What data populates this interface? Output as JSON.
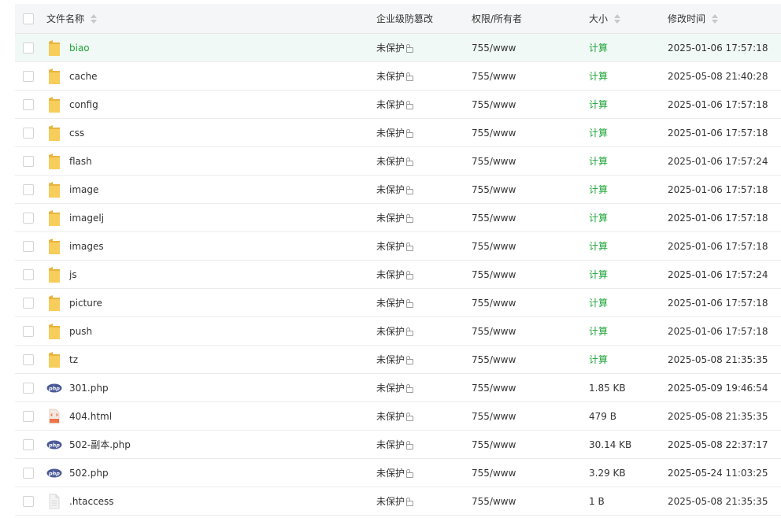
{
  "columns": {
    "name": "文件名称",
    "protect": "企业级防篡改",
    "perm": "权限/所有者",
    "size": "大小",
    "mtime": "修改时间"
  },
  "colors": {
    "accent_green": "#20a53a",
    "selected_row_bg": "#f1f9f6",
    "header_bg": "#f5f6f7",
    "folder": "#f4c752",
    "php_badge": "#4c5b97",
    "html_icon": "#ee7148"
  },
  "files": [
    {
      "name": "biao",
      "type": "folder",
      "icon": "folder-icon",
      "protect": "未保护",
      "perm": "755/www",
      "size": "计算",
      "mtime": "2025-01-06 17:57:18",
      "selected": true
    },
    {
      "name": "cache",
      "type": "folder",
      "icon": "folder-icon",
      "protect": "未保护",
      "perm": "755/www",
      "size": "计算",
      "mtime": "2025-05-08 21:40:28"
    },
    {
      "name": "config",
      "type": "folder",
      "icon": "folder-icon",
      "protect": "未保护",
      "perm": "755/www",
      "size": "计算",
      "mtime": "2025-01-06 17:57:18"
    },
    {
      "name": "css",
      "type": "folder",
      "icon": "folder-icon",
      "protect": "未保护",
      "perm": "755/www",
      "size": "计算",
      "mtime": "2025-01-06 17:57:18"
    },
    {
      "name": "flash",
      "type": "folder",
      "icon": "folder-icon",
      "protect": "未保护",
      "perm": "755/www",
      "size": "计算",
      "mtime": "2025-01-06 17:57:24"
    },
    {
      "name": "image",
      "type": "folder",
      "icon": "folder-icon",
      "protect": "未保护",
      "perm": "755/www",
      "size": "计算",
      "mtime": "2025-01-06 17:57:18"
    },
    {
      "name": "imagelj",
      "type": "folder",
      "icon": "folder-icon",
      "protect": "未保护",
      "perm": "755/www",
      "size": "计算",
      "mtime": "2025-01-06 17:57:18"
    },
    {
      "name": "images",
      "type": "folder",
      "icon": "folder-icon",
      "protect": "未保护",
      "perm": "755/www",
      "size": "计算",
      "mtime": "2025-01-06 17:57:18"
    },
    {
      "name": "js",
      "type": "folder",
      "icon": "folder-icon",
      "protect": "未保护",
      "perm": "755/www",
      "size": "计算",
      "mtime": "2025-01-06 17:57:24"
    },
    {
      "name": "picture",
      "type": "folder",
      "icon": "folder-icon",
      "protect": "未保护",
      "perm": "755/www",
      "size": "计算",
      "mtime": "2025-01-06 17:57:18"
    },
    {
      "name": "push",
      "type": "folder",
      "icon": "folder-icon",
      "protect": "未保护",
      "perm": "755/www",
      "size": "计算",
      "mtime": "2025-01-06 17:57:18"
    },
    {
      "name": "tz",
      "type": "folder",
      "icon": "folder-icon",
      "protect": "未保护",
      "perm": "755/www",
      "size": "计算",
      "mtime": "2025-05-08 21:35:35"
    },
    {
      "name": "301.php",
      "type": "php",
      "icon": "php-file-icon",
      "protect": "未保护",
      "perm": "755/www",
      "size": "1.85 KB",
      "mtime": "2025-05-09 19:46:54"
    },
    {
      "name": "404.html",
      "type": "html",
      "icon": "html-file-icon",
      "protect": "未保护",
      "perm": "755/www",
      "size": "479 B",
      "mtime": "2025-05-08 21:35:35"
    },
    {
      "name": "502-副本.php",
      "type": "php",
      "icon": "php-file-icon",
      "protect": "未保护",
      "perm": "755/www",
      "size": "30.14 KB",
      "mtime": "2025-05-08 22:37:17"
    },
    {
      "name": "502.php",
      "type": "php",
      "icon": "php-file-icon",
      "protect": "未保护",
      "perm": "755/www",
      "size": "3.29 KB",
      "mtime": "2025-05-24 11:03:25"
    },
    {
      "name": ".htaccess",
      "type": "generic",
      "icon": "generic-file-icon",
      "protect": "未保护",
      "perm": "755/www",
      "size": "1 B",
      "mtime": "2025-05-08 21:35:35"
    }
  ]
}
